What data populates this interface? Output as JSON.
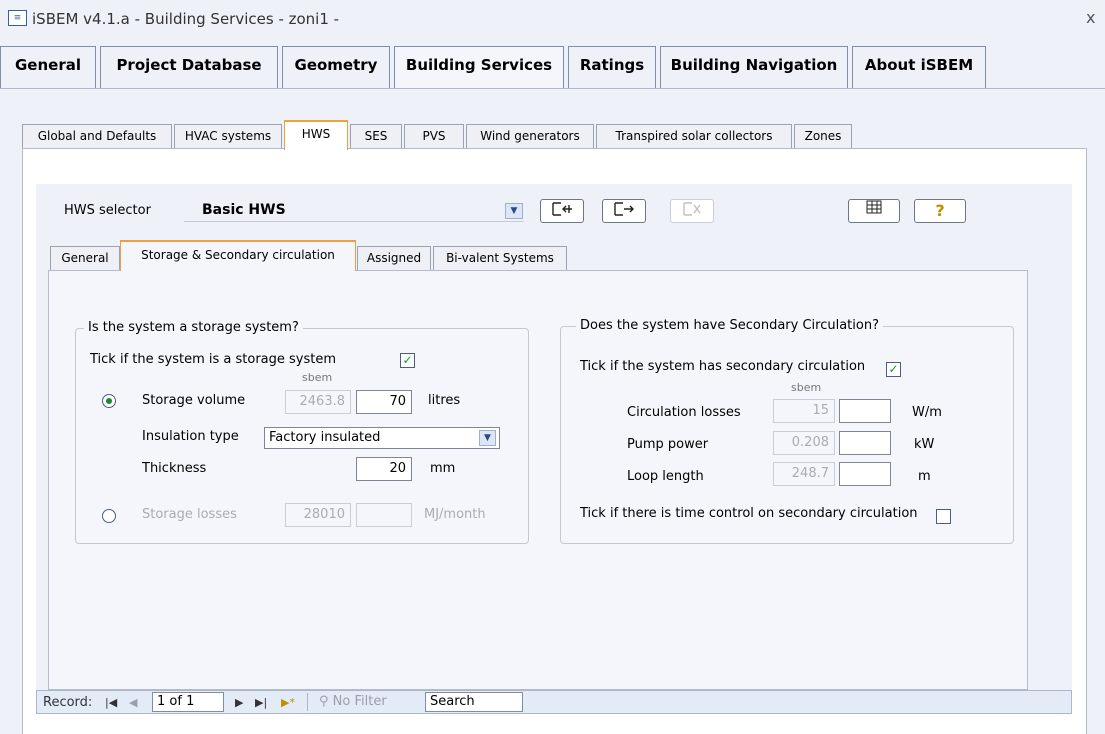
{
  "window": {
    "title": "iSBEM v4.1.a - Building Services - zoni1 -",
    "close": "x"
  },
  "top_tabs": [
    "General",
    "Project Database",
    "Geometry",
    "Building Services",
    "Ratings",
    "Building Navigation",
    "About iSBEM"
  ],
  "sub_tabs": [
    "Global and Defaults",
    "HVAC systems",
    "HWS",
    "SES",
    "PVS",
    "Wind generators",
    "Transpired solar collectors",
    "Zones"
  ],
  "hws": {
    "selector_label": "HWS selector",
    "selector_value": "Basic HWS"
  },
  "inner_tabs": [
    "General",
    "Storage & Secondary circulation",
    "Assigned",
    "Bi-valent Systems"
  ],
  "storage": {
    "group_title": "Is the system a storage system?",
    "tick_label": "Tick if the system is a storage system",
    "tick_checked": true,
    "sbem_label": "sbem",
    "volume_label": "Storage volume",
    "volume_sbem": "2463.8",
    "volume_value": "70",
    "volume_unit": "litres",
    "insulation_label": "Insulation type",
    "insulation_value": "Factory insulated",
    "thickness_label": "Thickness",
    "thickness_value": "20",
    "thickness_unit": "mm",
    "losses_label": "Storage losses",
    "losses_sbem": "28010",
    "losses_value": "",
    "losses_unit": "MJ/month"
  },
  "secondary": {
    "group_title": "Does the system have Secondary Circulation?",
    "tick_label": "Tick if the system has secondary circulation",
    "tick_checked": true,
    "sbem_label": "sbem",
    "rows": [
      {
        "label": "Circulation losses",
        "sbem": "15",
        "value": "",
        "unit": "W/m"
      },
      {
        "label": "Pump power",
        "sbem": "0.208",
        "value": "",
        "unit": "kW"
      },
      {
        "label": "Loop length",
        "sbem": "248.7",
        "value": "",
        "unit": "m"
      }
    ],
    "time_control_label": "Tick if there is time control on secondary circulation",
    "time_control_checked": false
  },
  "record_nav": {
    "label": "Record:",
    "position": "1 of 1",
    "filter": "No Filter",
    "search": "Search"
  }
}
